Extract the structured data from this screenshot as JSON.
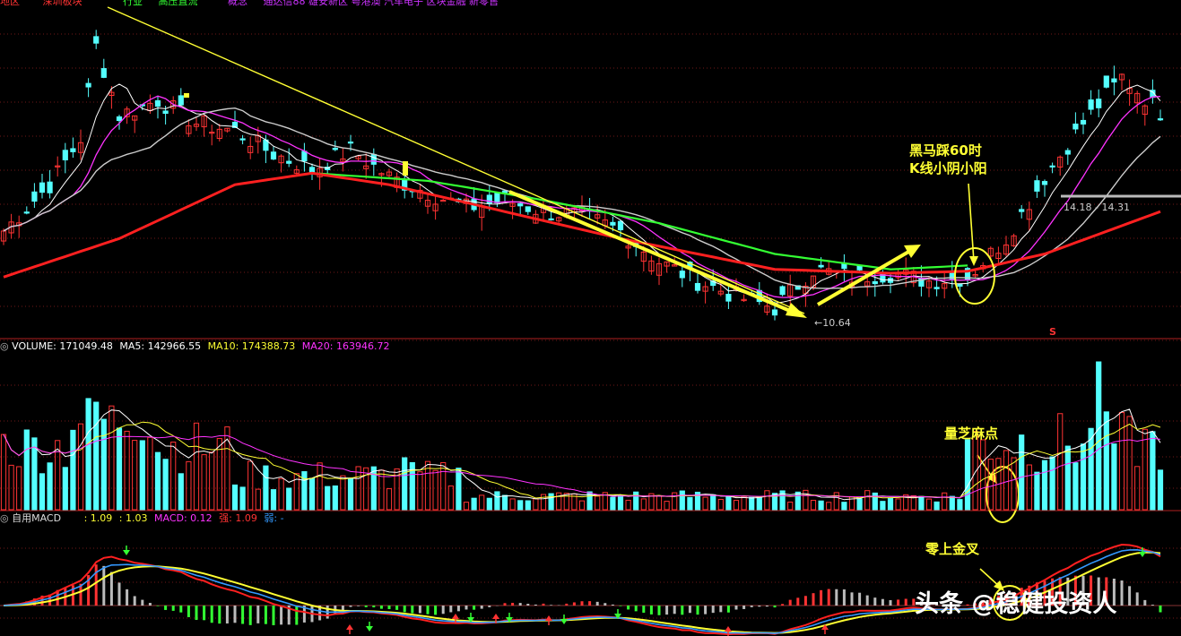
{
  "top_bar": {
    "items": [
      {
        "text": "地区",
        "color": "#FF3333"
      },
      {
        "text": "深圳板块",
        "color": "#FF3333"
      },
      {
        "text": "行业",
        "color": "#33FF33"
      },
      {
        "text": "高压直流",
        "color": "#33FF33"
      },
      {
        "text": "概念",
        "color": "#CC33FF"
      },
      {
        "text": "通达信88 雄安新区 粤港澳 汽车电子 区块金融 新零售",
        "color": "#CC33FF"
      }
    ]
  },
  "volume_header": {
    "label": "VOLUME: 171049.48",
    "ma5": "MA5: 142966.55",
    "ma10": "MA10: 174388.73",
    "ma20": "MA20: 163946.72"
  },
  "macd_header": {
    "label": "自用MACD",
    "diff": ": 1.09",
    "dea": ": 1.03",
    "macd": "MACD: 0.12",
    "strong": "强: 1.09",
    "weak": "弱: -"
  },
  "annotations": {
    "black_horse_line1": "黑马踩60时",
    "black_horse_line2": "K线小阴小阳",
    "volume_note": "量芝麻点",
    "macd_note": "零上金叉",
    "low_price": "10.64",
    "range_label": "14.18 - 14.31",
    "s_marker": "S"
  },
  "watermark": "头条 @稳健投资人",
  "colors": {
    "up": "#FF3333",
    "down": "#54FFFF",
    "ma_short": "#FFFFFF",
    "ma_mid": "#FF33FF",
    "ma60": "#33FF33",
    "ma120": "#FF2020",
    "dif": "#FFFF33",
    "dea": "#3399FF",
    "annotation": "#FFFF33"
  },
  "chart_data": [
    {
      "type": "candlestick",
      "panel": "price",
      "low_label": 10.64,
      "range_label": [
        14.18,
        14.31
      ],
      "close_trend": [
        [
          0,
          12.8
        ],
        [
          6,
          14.0
        ],
        [
          10,
          15.2
        ],
        [
          12,
          17.6
        ],
        [
          15,
          15.8
        ],
        [
          20,
          16.2
        ],
        [
          25,
          15.6
        ],
        [
          30,
          15.4
        ],
        [
          35,
          14.8
        ],
        [
          40,
          14.4
        ],
        [
          45,
          14.9
        ],
        [
          50,
          14.2
        ],
        [
          55,
          13.8
        ],
        [
          60,
          13.4
        ],
        [
          65,
          13.6
        ],
        [
          70,
          13.3
        ],
        [
          75,
          13.2
        ],
        [
          80,
          12.8
        ],
        [
          85,
          12.0
        ],
        [
          90,
          11.5
        ],
        [
          95,
          11.1
        ],
        [
          100,
          10.8
        ],
        [
          105,
          11.8
        ],
        [
          110,
          11.6
        ],
        [
          115,
          11.7
        ],
        [
          120,
          11.5
        ],
        [
          125,
          11.6
        ],
        [
          130,
          12.6
        ],
        [
          135,
          14.2
        ],
        [
          140,
          15.6
        ],
        [
          145,
          16.8
        ],
        [
          150,
          15.9
        ]
      ],
      "ma120_trend": [
        [
          0,
          11.6
        ],
        [
          15,
          12.6
        ],
        [
          30,
          14.0
        ],
        [
          40,
          14.3
        ],
        [
          50,
          14.0
        ],
        [
          80,
          12.6
        ],
        [
          100,
          11.8
        ],
        [
          115,
          11.7
        ],
        [
          125,
          11.75
        ],
        [
          135,
          12.2
        ],
        [
          150,
          13.3
        ]
      ],
      "ma60_trend": [
        [
          40,
          14.3
        ],
        [
          55,
          14.1
        ],
        [
          70,
          13.6
        ],
        [
          85,
          13.0
        ],
        [
          100,
          12.2
        ],
        [
          115,
          11.8
        ],
        [
          125,
          11.9
        ]
      ]
    },
    {
      "type": "bar",
      "panel": "volume",
      "current": 171049.48,
      "ma5": 142966.55,
      "ma10": 174388.73,
      "ma20": 163946.72
    },
    {
      "type": "bar",
      "panel": "macd",
      "diff": 1.09,
      "dea": 1.03,
      "macd": 0.12
    }
  ]
}
